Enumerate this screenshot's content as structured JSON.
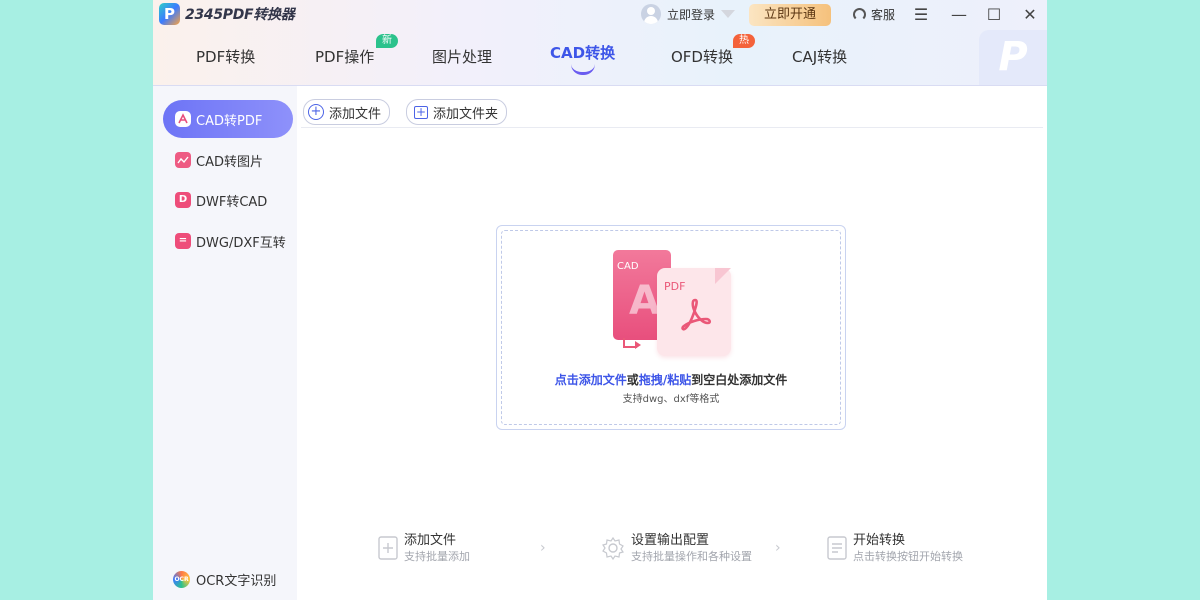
{
  "app": {
    "logo_text": "2345PDF转换器",
    "logo_badge": "P"
  },
  "header": {
    "login_label": "立即登录",
    "vip_button_label": "立即开通",
    "service_label": "客服",
    "window_controls": [
      "menu-icon",
      "minimize-icon",
      "maximize-icon",
      "close-icon"
    ],
    "deco_letter": "P"
  },
  "tabs": [
    {
      "label": "PDF转换",
      "active": false,
      "badge": ""
    },
    {
      "label": "PDF操作",
      "active": false,
      "badge": "新"
    },
    {
      "label": "图片处理",
      "active": false,
      "badge": ""
    },
    {
      "label": "CAD转换",
      "active": true,
      "badge": ""
    },
    {
      "label": "OFD转换",
      "active": false,
      "badge": "热"
    },
    {
      "label": "CAJ转换",
      "active": false,
      "badge": ""
    }
  ],
  "sidebar": {
    "items": [
      {
        "label": "CAD转PDF",
        "icon": "pdf-icon",
        "active": true
      },
      {
        "label": "CAD转图片",
        "icon": "image-icon",
        "active": false
      },
      {
        "label": "DWF转CAD",
        "icon": "dwf-icon",
        "active": false
      },
      {
        "label": "DWG/DXF互转",
        "icon": "dwg-icon",
        "active": false
      }
    ],
    "ocr_label": "OCR文字识别",
    "ocr_icon_text": "OCR"
  },
  "toolbar": {
    "add_file_label": "添加文件",
    "add_folder_label": "添加文件夹"
  },
  "dropzone": {
    "cad_label": "CAD",
    "cad_letter": "A",
    "pdf_label": "PDF",
    "hint_part1": "点击添加文件",
    "hint_part2": "或",
    "hint_part3": "拖拽/粘贴",
    "hint_part4": "到空白处添加文件",
    "formats": "支持dwg、dxf等格式"
  },
  "steps": [
    {
      "title": "添加文件",
      "desc": "支持批量添加",
      "icon": "add-file-icon"
    },
    {
      "title": "设置输出配置",
      "desc": "支持批量操作和各种设置",
      "icon": "settings-icon"
    },
    {
      "title": "开始转换",
      "desc": "点击转换按钮开始转换",
      "icon": "convert-icon"
    }
  ],
  "colors": {
    "accent": "#3e56e8",
    "sidebar_active": "#6d74f6",
    "pink": "#ea5878",
    "new_badge": "#2bc28c",
    "hot_badge": "#f4623a"
  }
}
